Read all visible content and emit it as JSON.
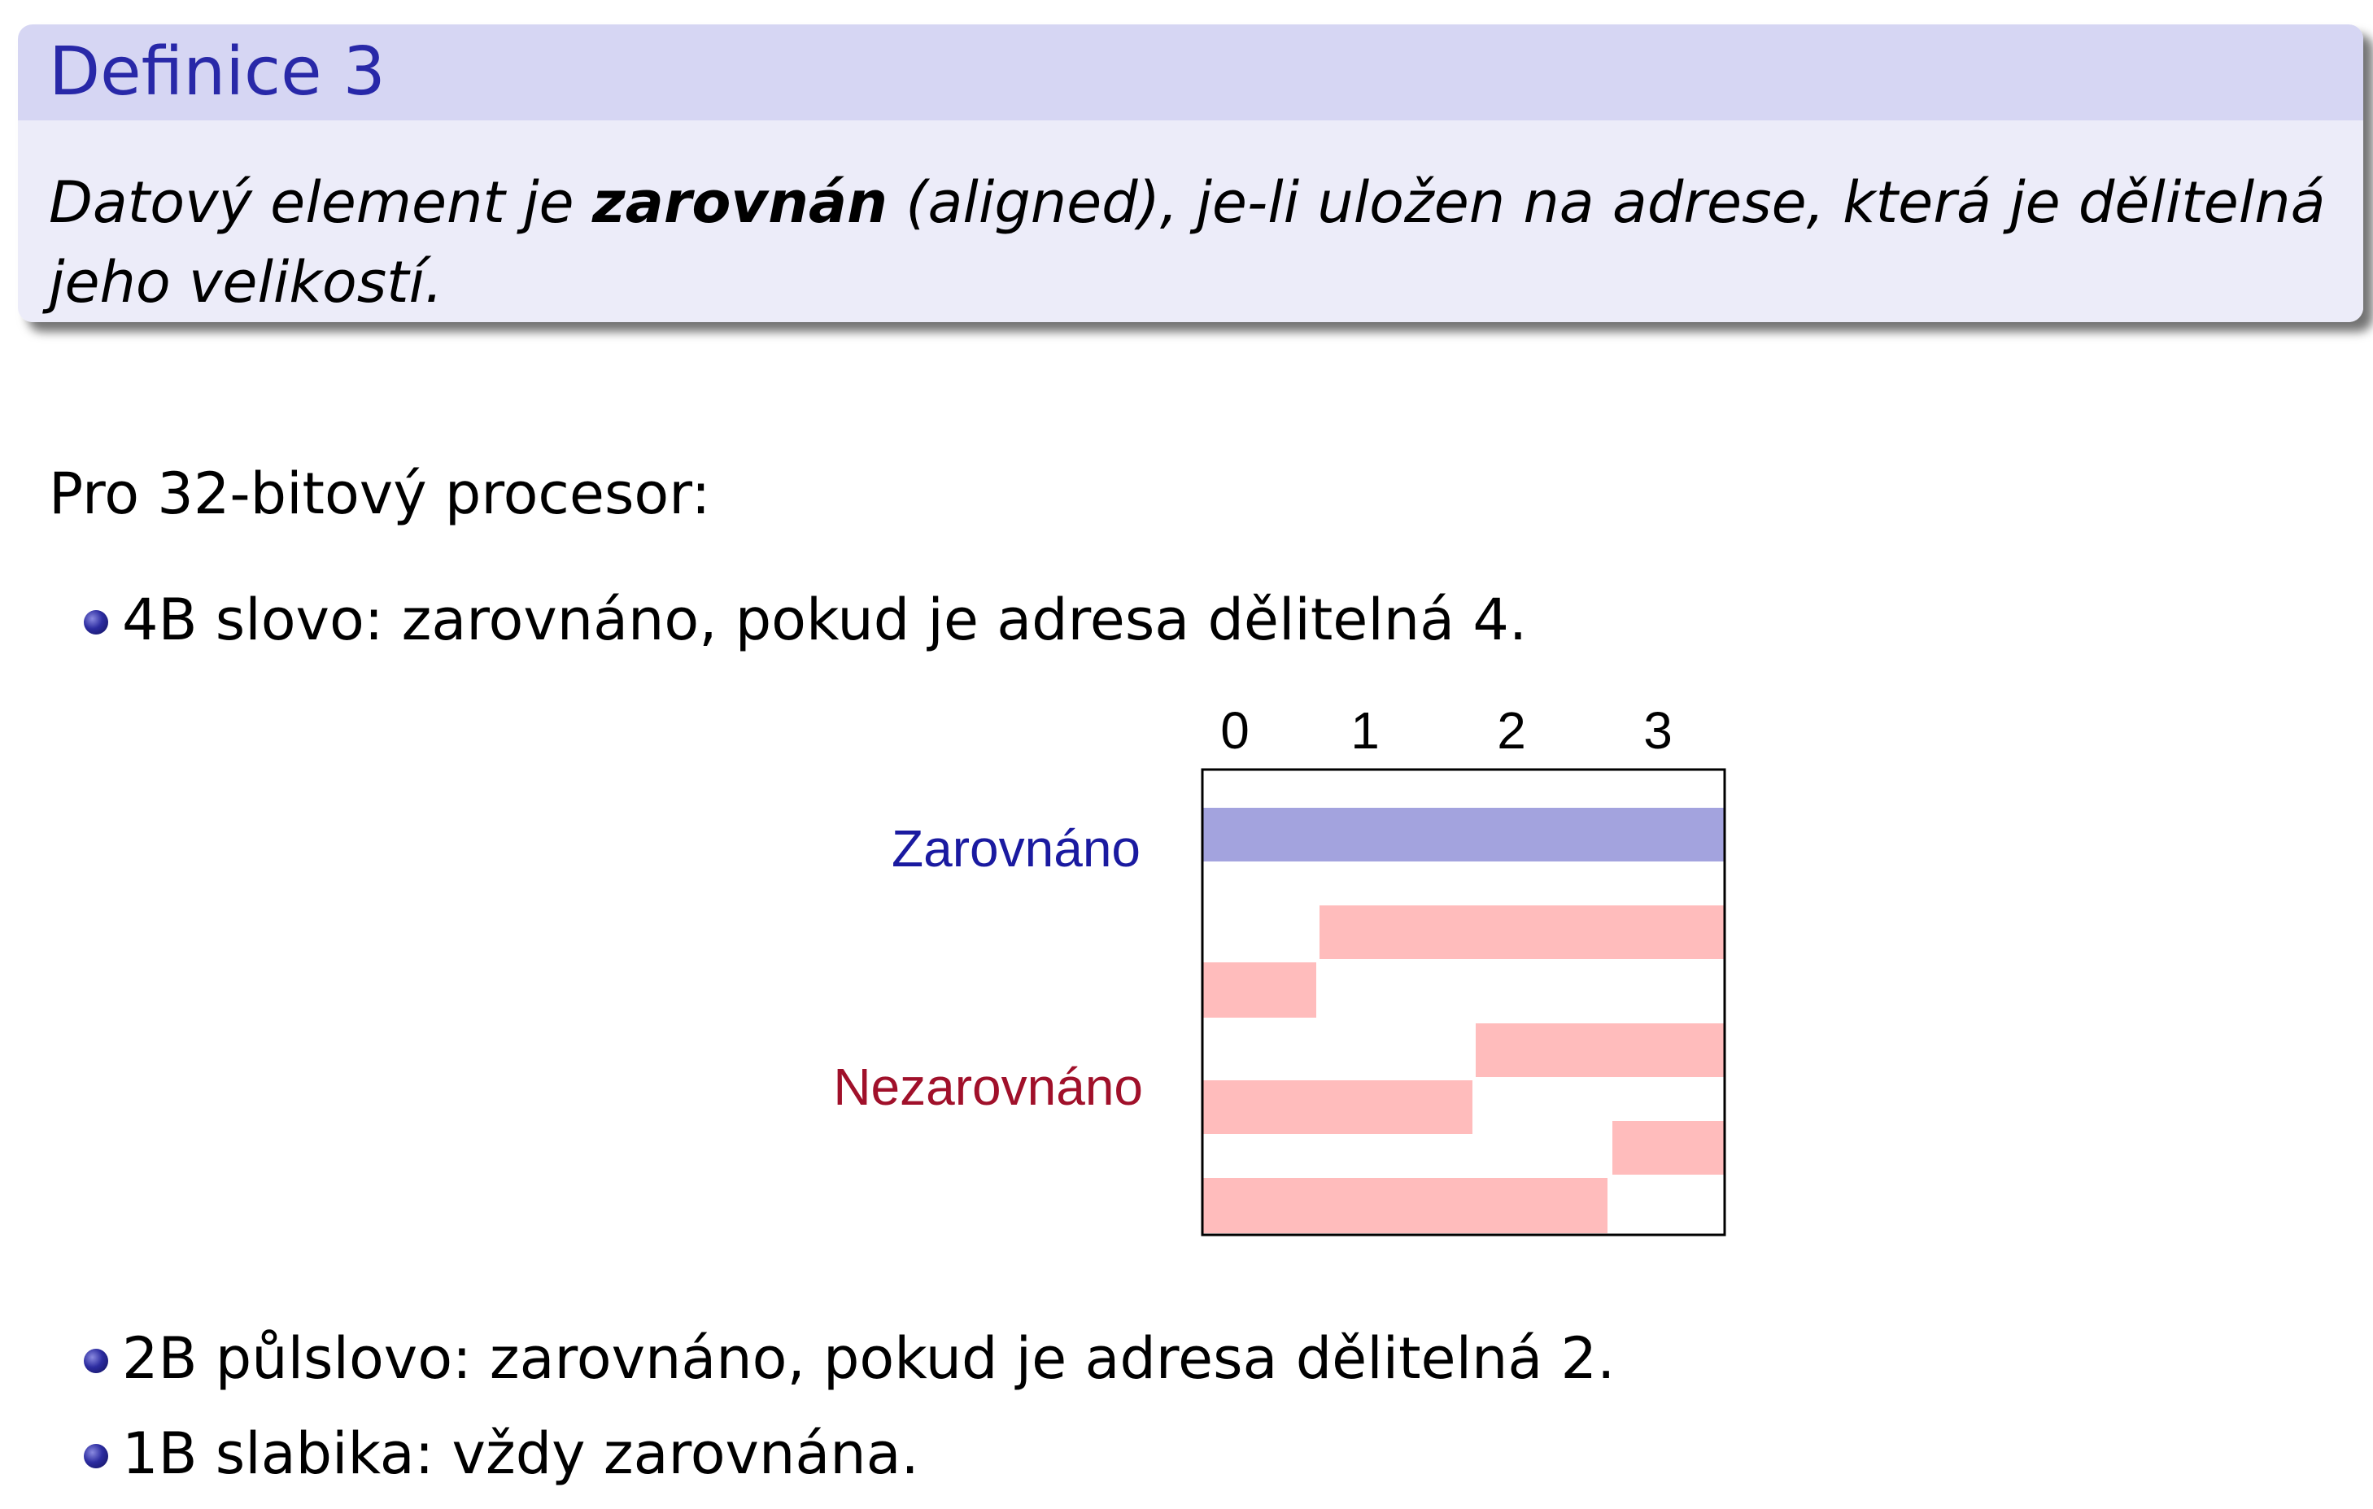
{
  "definition": {
    "title": "Definice 3",
    "text_before": "Datový element je ",
    "text_bold": "zarovnán",
    "text_after": " (aligned), je-li uložen na adrese, která je dělitelná jeho velikostí."
  },
  "intro": "Pro 32-bitový procesor:",
  "bullets": [
    "4B slovo: zarovnáno, pokud je adresa dělitelná 4.",
    "2B půlslovo: zarovnáno, pokud je adresa dělitelná 2.",
    "1B slabika: vždy zarovnána."
  ],
  "diagram": {
    "columns": [
      "0",
      "1",
      "2",
      "3"
    ],
    "label_aligned": "Zarovnáno",
    "label_unaligned": "Nezarovnáno",
    "colors": {
      "aligned": "#a3a3de",
      "unaligned": "#ffbcbc",
      "label_aligned": "#1a1aa0",
      "label_unaligned": "#a0102a"
    }
  }
}
